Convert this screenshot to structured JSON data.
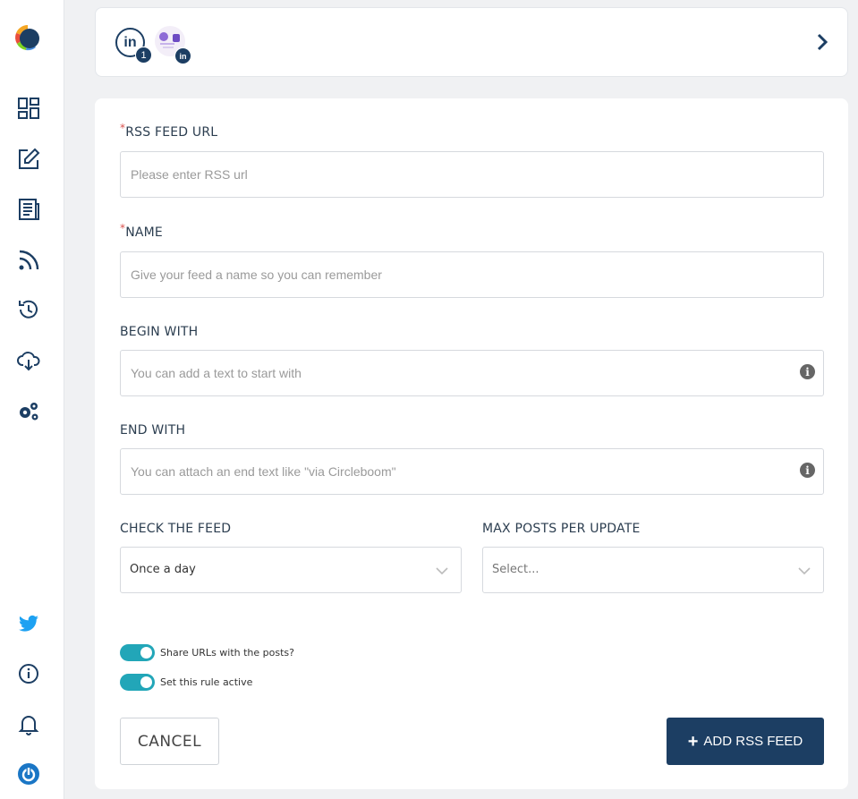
{
  "sidebar": {
    "items": [
      {
        "icon": "dashboard-icon"
      },
      {
        "icon": "edit-icon"
      },
      {
        "icon": "newspaper-icon"
      },
      {
        "icon": "rss-icon"
      },
      {
        "icon": "history-icon"
      },
      {
        "icon": "cloud-download-icon"
      },
      {
        "icon": "gears-icon"
      }
    ],
    "bottom": [
      {
        "icon": "twitter-icon"
      },
      {
        "icon": "info-icon"
      },
      {
        "icon": "bell-icon"
      },
      {
        "icon": "power-icon"
      }
    ]
  },
  "account_card": {
    "linkedin_initials": "in",
    "account_count": "1",
    "page_network_initials": "in"
  },
  "form": {
    "rss_url": {
      "label": "RSS FEED URL",
      "required_mark": "*",
      "placeholder": "Please enter RSS url",
      "value": ""
    },
    "name": {
      "label": "NAME",
      "required_mark": "*",
      "placeholder": "Give your feed a name so you can remember",
      "value": ""
    },
    "begin_with": {
      "label": "BEGIN WITH",
      "placeholder": "You can add a text to start with",
      "value": ""
    },
    "end_with": {
      "label": "END WITH",
      "placeholder": "You can attach an end text like \"via Circleboom\"",
      "value": ""
    },
    "check_feed": {
      "label": "CHECK THE FEED",
      "selected": "Once a day"
    },
    "max_posts": {
      "label": "MAX POSTS PER UPDATE",
      "placeholder": "Select..."
    },
    "toggles": [
      {
        "label": "Share URLs with the posts?",
        "on": true
      },
      {
        "label": "Set this rule active",
        "on": true
      }
    ],
    "cancel_label": "CANCEL",
    "add_label": "ADD RSS FEED",
    "add_icon": "+"
  },
  "colors": {
    "primary": "#1c3e63",
    "toggle_on": "#22a6b8",
    "required": "#d9534f",
    "twitter": "#1da1f2"
  }
}
